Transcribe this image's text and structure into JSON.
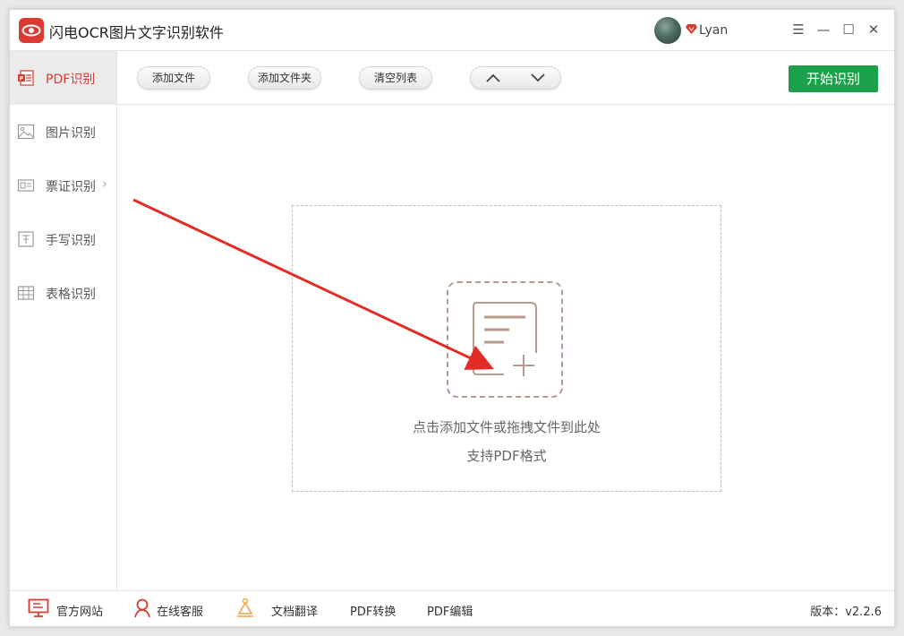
{
  "app": {
    "title": "闪电OCR图片文字识别软件",
    "username": "Lyan",
    "brand_color": "#d93a32",
    "accent_green": "#1ba14a"
  },
  "window_controls": {
    "menu": "☰",
    "minimize": "—",
    "maximize": "☐",
    "close": "✕"
  },
  "sidebar": {
    "items": [
      {
        "label": "PDF识别",
        "icon": "pdf-icon",
        "active": true
      },
      {
        "label": "图片识别",
        "icon": "image-icon",
        "active": false
      },
      {
        "label": "票证识别",
        "icon": "ticket-icon",
        "active": false,
        "has_submenu": true
      },
      {
        "label": "手写识别",
        "icon": "handwriting-icon",
        "active": false
      },
      {
        "label": "表格识别",
        "icon": "table-icon",
        "active": false
      }
    ],
    "submenu_chevron": "›"
  },
  "toolbar": {
    "add_file": "添加文件",
    "add_folder": "添加文件夹",
    "clear_list": "清空列表",
    "start": "开始识别"
  },
  "dropzone": {
    "hint": "点击添加文件或拖拽文件到此处",
    "sub": "支持PDF格式"
  },
  "footer": {
    "website": "官方网站",
    "support": "在线客服",
    "translate": "文档翻译",
    "pdf_convert": "PDF转换",
    "pdf_edit": "PDF编辑",
    "version": "版本：v2.2.6"
  }
}
